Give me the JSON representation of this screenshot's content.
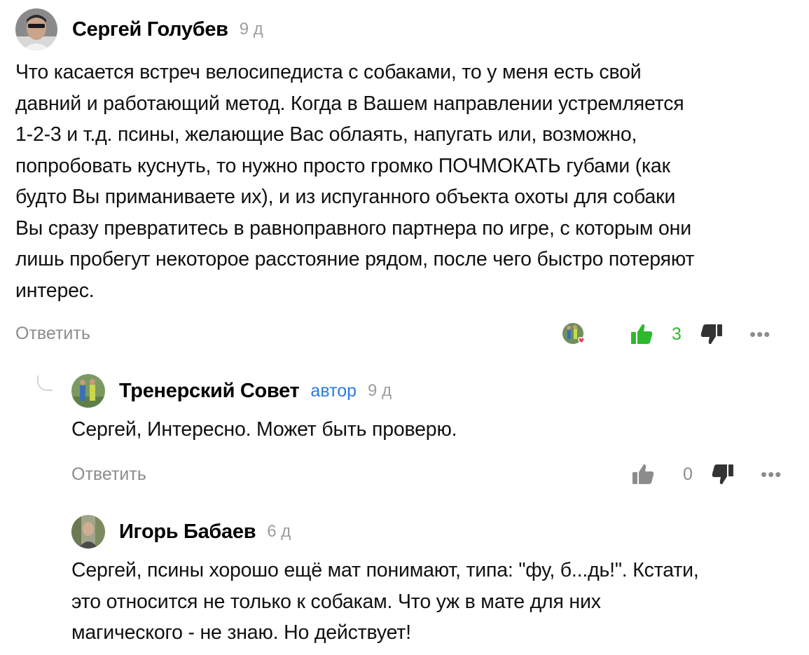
{
  "comments": [
    {
      "author": "Сергей Голубев",
      "time": "9 д",
      "text": "Что касается встреч велосипедиста с собаками, то у меня есть свой\nдавний и работающий метод. Когда в Вашем направлении устремляется\n1-2-3 и т.д. псины, желающие Вас облаять, напугать или, возможно,\nпопробовать куснуть, то нужно просто громко ПОЧМОКАТЬ губами (как\nбудто Вы приманиваете их), и из испуганного объекта охоты для собаки\nВы сразу превратитесь в равноправного партнера по игре, с которым они\nлишь пробегут некоторое расстояние рядом, после чего быстро потеряют\nинтерес.",
      "reply_label": "Ответить",
      "likes": "3",
      "liked": true,
      "more": "•••"
    },
    {
      "author": "Тренерский Совет",
      "badge": "автор",
      "time": "9 д",
      "text": "Сергей, Интересно. Может быть проверю.",
      "reply_label": "Ответить",
      "likes": "0",
      "liked": false,
      "more": "•••"
    },
    {
      "author": "Игорь Бабаев",
      "time": "6 д",
      "text": "Сергей, псины хорошо ещё мат понимают, типа: \"фу, б...дь!\". Кстати,\nэто относится не только к собакам. Что уж в мате для них\nмагического - не знаю. Но действует!"
    }
  ],
  "colors": {
    "like_active": "#2eb82e",
    "icon_gray": "#8c8c8c",
    "icon_dark": "#333333",
    "badge": "#2b7be0",
    "heart": "#e8364b"
  }
}
